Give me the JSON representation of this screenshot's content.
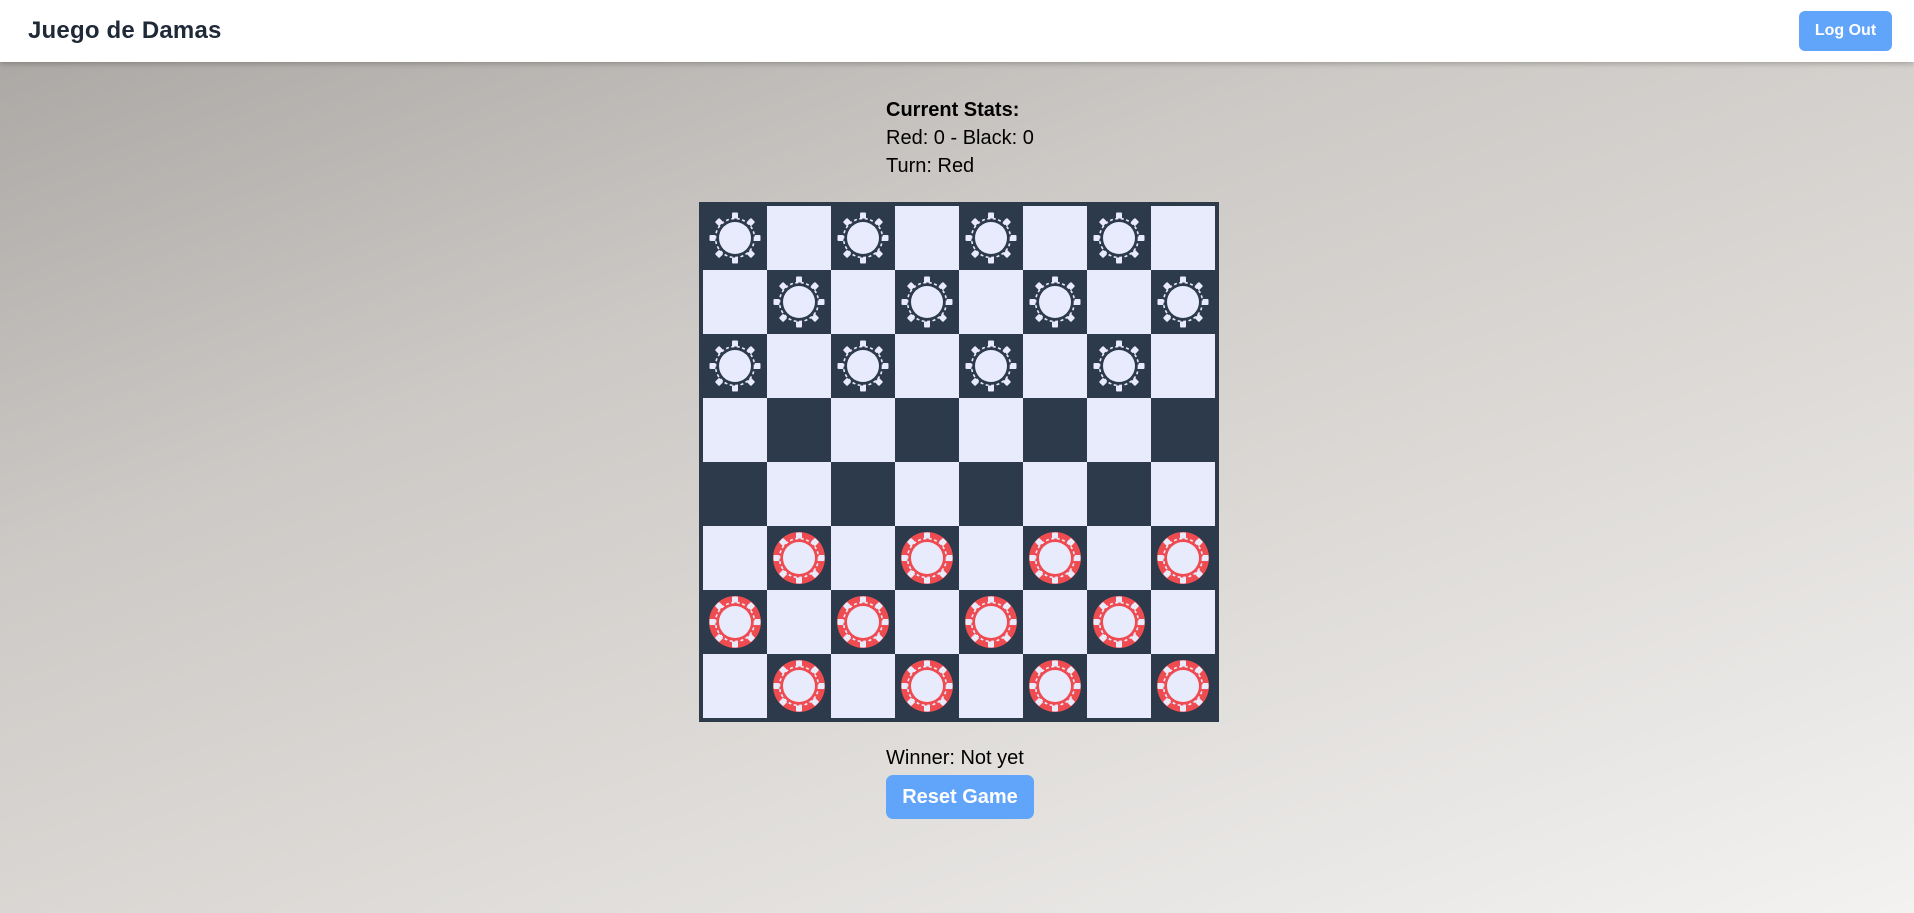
{
  "header": {
    "title": "Juego de Damas",
    "logout_label": "Log Out"
  },
  "stats": {
    "heading": "Current Stats:",
    "score": "Red: 0 - Black: 0",
    "turn": "Turn: Red"
  },
  "board": {
    "rows": [
      [
        "B",
        "",
        "B",
        "",
        "B",
        "",
        "B",
        ""
      ],
      [
        "",
        "B",
        "",
        "B",
        "",
        "B",
        "",
        "B"
      ],
      [
        "B",
        "",
        "B",
        "",
        "B",
        "",
        "B",
        ""
      ],
      [
        "",
        "",
        "",
        "",
        "",
        "",
        "",
        ""
      ],
      [
        "",
        "",
        "",
        "",
        "",
        "",
        "",
        ""
      ],
      [
        "",
        "R",
        "",
        "R",
        "",
        "R",
        "",
        "R"
      ],
      [
        "R",
        "",
        "R",
        "",
        "R",
        "",
        "R",
        ""
      ],
      [
        "",
        "R",
        "",
        "R",
        "",
        "R",
        "",
        "R"
      ]
    ],
    "colors": {
      "light_square": "#e8ebfc",
      "dark_square": "#2c3a4b",
      "black_piece": "#2c3a4b",
      "red_piece": "#ef4c52",
      "piece_center": "#e8ebfc"
    }
  },
  "footer": {
    "winner": "Winner: Not yet",
    "reset_label": "Reset Game"
  }
}
